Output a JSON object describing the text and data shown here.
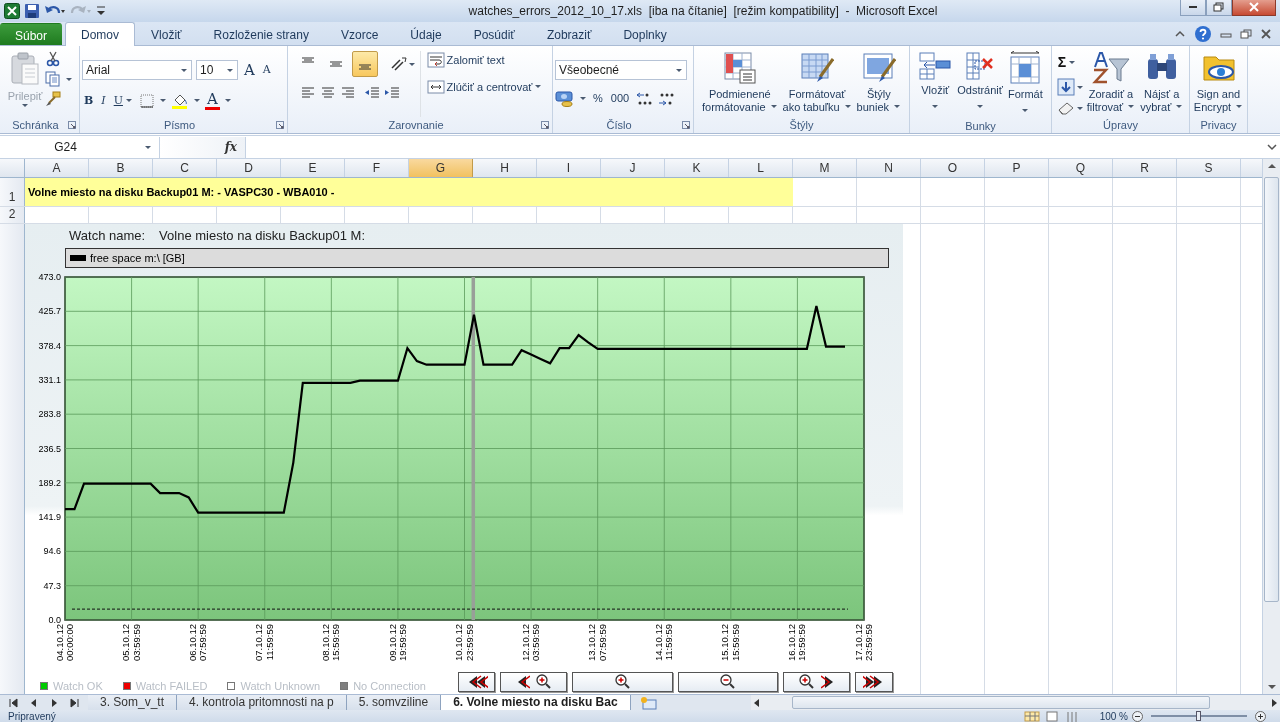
{
  "title_bar": {
    "title": "watches_errors_2012_10_17.xls  [iba na čítanie]  [režim kompatibility]  -  Microsoft Excel"
  },
  "ribbon_tabs": [
    {
      "label": "Súbor",
      "kind": "file",
      "selected": false
    },
    {
      "label": "Domov",
      "kind": "tab",
      "selected": true
    },
    {
      "label": "Vložiť",
      "kind": "tab",
      "selected": false
    },
    {
      "label": "Rozloženie strany",
      "kind": "tab",
      "selected": false
    },
    {
      "label": "Vzorce",
      "kind": "tab",
      "selected": false
    },
    {
      "label": "Údaje",
      "kind": "tab",
      "selected": false
    },
    {
      "label": "Posúdiť",
      "kind": "tab",
      "selected": false
    },
    {
      "label": "Zobraziť",
      "kind": "tab",
      "selected": false
    },
    {
      "label": "Doplnky",
      "kind": "tab",
      "selected": false
    }
  ],
  "ribbon_groups": [
    {
      "kind": "clipboard",
      "label": "Schránka",
      "paste": {
        "label": "Prilepiť",
        "disabled": true
      }
    },
    {
      "kind": "font",
      "label": "Písmo",
      "font_name": "Arial",
      "font_size": "10",
      "grow": "A",
      "shrink": "A",
      "styles": [
        "B",
        "I",
        "U"
      ],
      "font_color": "A"
    },
    {
      "kind": "alignment",
      "label": "Zarovnanie",
      "vertical_align": [
        {
          "selected": false
        },
        {
          "selected": false
        },
        {
          "selected": true
        }
      ],
      "wrap_text": "Zalomiť text",
      "merge": "Zlúčiť a centrovať"
    },
    {
      "kind": "number",
      "label": "Číslo",
      "format": "Všeobecné",
      "symbols": [
        "%",
        "000"
      ]
    },
    {
      "kind": "buttons",
      "label": "Štýly",
      "buttons": [
        {
          "kind": "conditional",
          "lines": [
            "Podmienené",
            "formátovanie"
          ],
          "dropdown": true
        },
        {
          "kind": "table",
          "lines": [
            "Formátovať",
            "ako tabuľku"
          ],
          "dropdown": true
        },
        {
          "kind": "cellstyles",
          "lines": [
            "Štýly",
            "buniek"
          ],
          "dropdown": true
        }
      ]
    },
    {
      "kind": "buttons",
      "label": "Bunky",
      "buttons": [
        {
          "kind": "insert",
          "lines": [
            "Vložiť"
          ],
          "dropdown": true
        },
        {
          "kind": "delete",
          "lines": [
            "Odstrániť"
          ],
          "dropdown": true
        },
        {
          "kind": "format",
          "lines": [
            "Formát"
          ],
          "dropdown": true
        }
      ]
    },
    {
      "kind": "editing",
      "label": "Úpravy",
      "sum": "Σ",
      "buttons": [
        {
          "kind": "sort",
          "lines": [
            "Zoradiť a",
            "filtrovať"
          ],
          "dropdown": true
        },
        {
          "kind": "find",
          "lines": [
            "Nájsť a",
            "vybrať"
          ],
          "dropdown": true
        }
      ]
    },
    {
      "kind": "buttons",
      "label": "Privacy",
      "buttons": [
        {
          "kind": "encrypt",
          "lines": [
            "Sign and",
            "Encrypt"
          ],
          "dropdown": true
        }
      ]
    }
  ],
  "formula_bar": {
    "name_box": "G24",
    "function_label": "fx"
  },
  "columns": [
    {
      "label": "A",
      "selected": false
    },
    {
      "label": "B",
      "selected": false
    },
    {
      "label": "C",
      "selected": false
    },
    {
      "label": "D",
      "selected": false
    },
    {
      "label": "E",
      "selected": false
    },
    {
      "label": "F",
      "selected": false
    },
    {
      "label": "G",
      "selected": true
    },
    {
      "label": "H",
      "selected": false
    },
    {
      "label": "I",
      "selected": false
    },
    {
      "label": "J",
      "selected": false
    },
    {
      "label": "K",
      "selected": false
    },
    {
      "label": "L",
      "selected": false
    },
    {
      "label": "M",
      "selected": false
    },
    {
      "label": "N",
      "selected": false
    },
    {
      "label": "O",
      "selected": false
    },
    {
      "label": "P",
      "selected": false
    },
    {
      "label": "Q",
      "selected": false
    },
    {
      "label": "R",
      "selected": false
    },
    {
      "label": "S",
      "selected": false
    }
  ],
  "rows": [
    {
      "label": "1",
      "title": "Volne miesto na disku Backup01 M: - VASPC30 - WBA010 -"
    },
    {
      "label": "2"
    }
  ],
  "watch_chart": {
    "watch_name_label": "Watch name:",
    "watch_name": "Volne miesto na disku Backup01 M:",
    "chart_data": {
      "type": "line",
      "categories": [
        "04.10.12 00:00:00",
        null,
        null,
        null,
        null,
        null,
        null,
        "05.10.12 03:59:59",
        null,
        null,
        null,
        null,
        null,
        null,
        "06.10.12 07:59:59",
        null,
        null,
        null,
        null,
        null,
        null,
        "07.10.12 11:59:59",
        null,
        null,
        null,
        null,
        null,
        null,
        "08.10.12 15:59:59",
        null,
        null,
        null,
        null,
        null,
        null,
        "09.10.12 19:59:59",
        null,
        null,
        null,
        null,
        null,
        null,
        "10.10.12 23:59:59",
        null,
        null,
        null,
        null,
        null,
        null,
        "12.10.12 03:59:59",
        null,
        null,
        null,
        null,
        null,
        null,
        "13.10.12 07:59:59",
        null,
        null,
        null,
        null,
        null,
        null,
        "14.10.12 11:59:59",
        null,
        null,
        null,
        null,
        null,
        null,
        "15.10.12 15:59:59",
        null,
        null,
        null,
        null,
        null,
        null,
        "16.10.12 19:59:59",
        null,
        null,
        null,
        null,
        null,
        null,
        "17.10.12 23:59:59"
      ],
      "series": [
        {
          "name": "free space m:\\ [GB]",
          "color": "#000000",
          "values": [
            153,
            153,
            188,
            188,
            188,
            188,
            188,
            188,
            188,
            188,
            175,
            175,
            175,
            169,
            148,
            148,
            148,
            148,
            148,
            148,
            148,
            148,
            148,
            148,
            217,
            327,
            327,
            327,
            327,
            327,
            327,
            330,
            330,
            330,
            330,
            330,
            375,
            357,
            352,
            352,
            352,
            352,
            352,
            421,
            352,
            352,
            352,
            352,
            372,
            366,
            360,
            354,
            375,
            375,
            393,
            383,
            374,
            374,
            374,
            374,
            374,
            374,
            374,
            374,
            374,
            374,
            374,
            374,
            374,
            374,
            374,
            374,
            374,
            374,
            374,
            374,
            374,
            374,
            374,
            433,
            377,
            377,
            377,
            null,
            null
          ]
        }
      ],
      "ylim": [
        0,
        473
      ],
      "yticks": [
        {
          "value": 0,
          "label": "0.0"
        },
        {
          "value": 47.3,
          "label": "47.3"
        },
        {
          "value": 94.6,
          "label": "94.6"
        },
        {
          "value": 141.9,
          "label": "141.9"
        },
        {
          "value": 189.2,
          "label": "189.2"
        },
        {
          "value": 236.5,
          "label": "236.5"
        },
        {
          "value": 283.8,
          "label": "283.8"
        },
        {
          "value": 331.1,
          "label": "331.1"
        },
        {
          "value": 378.4,
          "label": "378.4"
        },
        {
          "value": 425.7,
          "label": "425.7"
        },
        {
          "value": 473,
          "label": "473.0"
        }
      ],
      "grid": true,
      "ref_lines": [
        {
          "axis": "y",
          "value": 15
        }
      ]
    },
    "status_legend": [
      {
        "label": "Watch OK",
        "color": "#00cc00"
      },
      {
        "label": "Watch FAILED",
        "color": "#ee0000"
      },
      {
        "label": "Watch Unknown",
        "color": "#ffffff"
      },
      {
        "label": "No Connection",
        "color": "#7f7f7f"
      }
    ],
    "nav_buttons": [
      {
        "kind": "first"
      },
      {
        "kind": "back-zoom"
      },
      {
        "kind": "zoom-in"
      },
      {
        "kind": "zoom-out"
      },
      {
        "kind": "zoom-forward"
      },
      {
        "kind": "last"
      }
    ]
  },
  "sheet_tabs": [
    {
      "label": "3. Som_v_tt",
      "selected": false
    },
    {
      "label": "4. kontrola pritomnosti na p",
      "selected": false
    },
    {
      "label": "5. somvziline",
      "selected": false
    },
    {
      "label": "6. Volne miesto na disku Bac",
      "selected": true
    }
  ],
  "status_bar": {
    "text": "Pripravený",
    "zoom": "100 %",
    "level": 0.5
  }
}
